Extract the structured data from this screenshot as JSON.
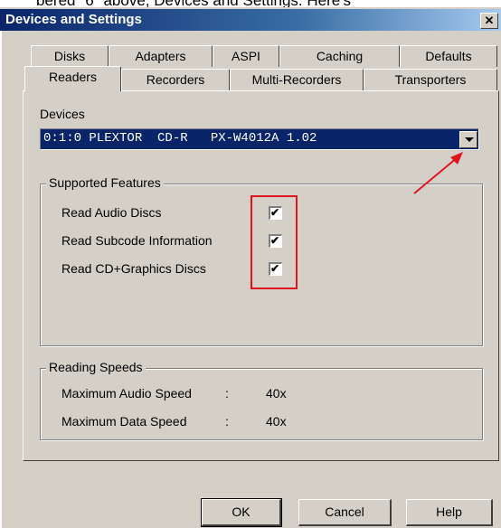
{
  "background_caption": "bered \"6\" above, Devices and Settings. Here's",
  "window": {
    "title": "Devices and Settings",
    "close_glyph": "✕"
  },
  "tabs_back": [
    {
      "label": "Disks"
    },
    {
      "label": "Adapters"
    },
    {
      "label": "ASPI"
    },
    {
      "label": "Caching"
    },
    {
      "label": "Defaults"
    }
  ],
  "tabs_front": [
    {
      "label": "Readers",
      "active": true
    },
    {
      "label": "Recorders"
    },
    {
      "label": "Multi-Recorders"
    },
    {
      "label": "Transporters"
    }
  ],
  "devices": {
    "label": "Devices",
    "selected": "0:1:0 PLEXTOR  CD-R   PX-W4012A 1.02"
  },
  "supported_features": {
    "title": "Supported Features",
    "items": [
      {
        "label": "Read Audio Discs",
        "checked": true
      },
      {
        "label": "Read Subcode Information",
        "checked": true
      },
      {
        "label": "Read CD+Graphics Discs",
        "checked": true
      }
    ]
  },
  "reading_speeds": {
    "title": "Reading Speeds",
    "rows": [
      {
        "label": "Maximum Audio Speed",
        "sep": ":",
        "value": "40x"
      },
      {
        "label": "Maximum Data Speed",
        "sep": ":",
        "value": "40x"
      }
    ]
  },
  "buttons": {
    "ok": "OK",
    "cancel": "Cancel",
    "help": "Help"
  },
  "colors": {
    "annotation_red": "#e0141e",
    "title_blue": "#0a246a",
    "face": "#d4d0c8"
  }
}
